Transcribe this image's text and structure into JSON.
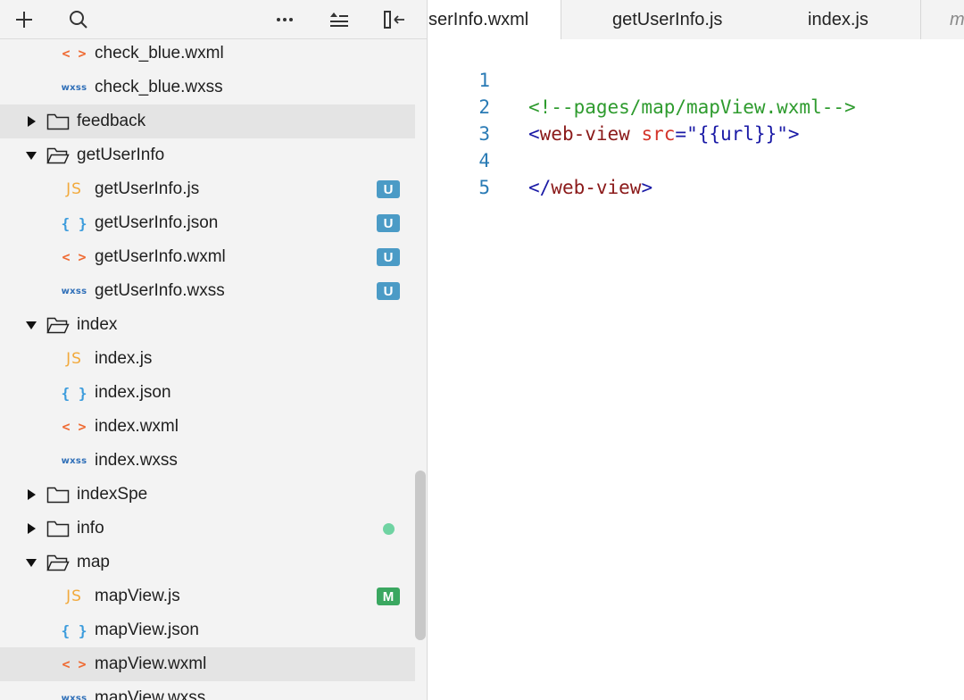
{
  "toolbar": {
    "icons": [
      "plus-icon",
      "search-icon",
      "more-icon",
      "collapse-all-icon",
      "toggle-sidebar-icon"
    ]
  },
  "tree": [
    {
      "kind": "file",
      "type": "wxml",
      "icon_text": "< >",
      "label": "check_blue.wxml"
    },
    {
      "kind": "file",
      "type": "wxss",
      "icon_text": "wxss",
      "label": "check_blue.wxss"
    },
    {
      "kind": "folder",
      "open": false,
      "label": "feedback"
    },
    {
      "kind": "folder",
      "open": true,
      "label": "getUserInfo"
    },
    {
      "kind": "file",
      "type": "js",
      "icon_text": "JS",
      "label": "getUserInfo.js",
      "badge": "U"
    },
    {
      "kind": "file",
      "type": "json",
      "icon_text": "{ }",
      "label": "getUserInfo.json",
      "badge": "U"
    },
    {
      "kind": "file",
      "type": "wxml",
      "icon_text": "< >",
      "label": "getUserInfo.wxml",
      "badge": "U"
    },
    {
      "kind": "file",
      "type": "wxss",
      "icon_text": "wxss",
      "label": "getUserInfo.wxss",
      "badge": "U"
    },
    {
      "kind": "folder",
      "open": true,
      "label": "index"
    },
    {
      "kind": "file",
      "type": "js",
      "icon_text": "JS",
      "label": "index.js"
    },
    {
      "kind": "file",
      "type": "json",
      "icon_text": "{ }",
      "label": "index.json"
    },
    {
      "kind": "file",
      "type": "wxml",
      "icon_text": "< >",
      "label": "index.wxml"
    },
    {
      "kind": "file",
      "type": "wxss",
      "icon_text": "wxss",
      "label": "index.wxss"
    },
    {
      "kind": "folder",
      "open": false,
      "label": "indexSpe"
    },
    {
      "kind": "folder",
      "open": false,
      "label": "info"
    },
    {
      "kind": "folder",
      "open": true,
      "label": "map"
    },
    {
      "kind": "file",
      "type": "js",
      "icon_text": "JS",
      "label": "mapView.js",
      "badge": "M"
    },
    {
      "kind": "file",
      "type": "json",
      "icon_text": "{ }",
      "label": "mapView.json"
    },
    {
      "kind": "file",
      "type": "wxml",
      "icon_text": "< >",
      "label": "mapView.wxml"
    },
    {
      "kind": "file",
      "type": "wxss",
      "icon_text": "wxss",
      "label": "mapView.wxss"
    }
  ],
  "tabs": {
    "tab1": "serInfo.wxml",
    "tab2": "getUserInfo.js",
    "tab3": "index.js",
    "tab4": "m"
  },
  "editor": {
    "line_numbers": [
      "1",
      "2",
      "3",
      "4",
      "5"
    ],
    "line1": {
      "comment": "<!--pages/map/mapView.wxml-->"
    },
    "line2": {
      "open": "<",
      "tag": "web-view",
      "attr": "src",
      "eq": "=",
      "value": "\"{{url}}\"",
      "close": ">"
    },
    "line4": {
      "open": "</",
      "tag": "web-view",
      "close": ">"
    }
  },
  "colors": {
    "badge_u": "#4b9bc6",
    "badge_m": "#3aa760",
    "status_dot": "#6fd3a2",
    "comment": "#2e9b2e",
    "tag": "#8b1a1a",
    "attr": "#d4342a",
    "line_number": "#2a7bb5"
  }
}
